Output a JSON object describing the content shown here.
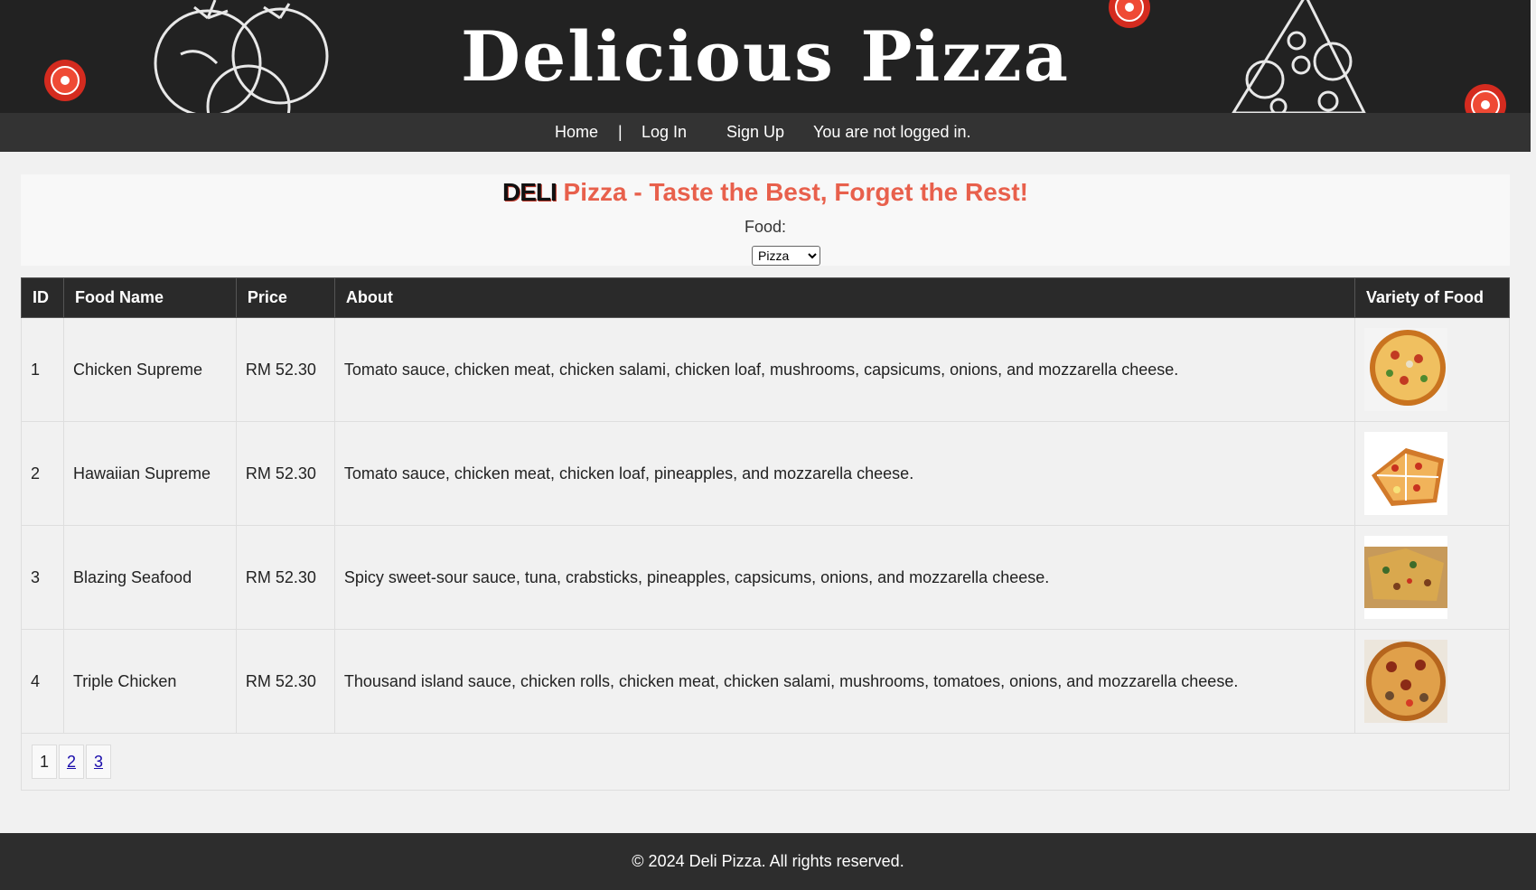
{
  "banner": {
    "title": "Delicious Pizza"
  },
  "nav": {
    "home": "Home",
    "separator": "|",
    "login": "Log In",
    "signup": "Sign Up",
    "status": "You are not logged in."
  },
  "hero": {
    "brand": "DELI",
    "tagline": "Pizza - Taste the Best, Forget the Rest!",
    "food_label": "Food:",
    "food_selected": "Pizza"
  },
  "table": {
    "headers": [
      "ID",
      "Food Name",
      "Price",
      "About",
      "Variety of Food"
    ],
    "rows": [
      {
        "id": "1",
        "name": "Chicken Supreme",
        "price": "RM 52.30",
        "about": "Tomato sauce, chicken meat, chicken salami, chicken loaf, mushrooms, capsicums, onions, and mozzarella cheese.",
        "image": "chicken-supreme-pizza-image"
      },
      {
        "id": "2",
        "name": "Hawaiian Supreme",
        "price": "RM 52.30",
        "about": "Tomato sauce, chicken meat, chicken loaf, pineapples, and mozzarella cheese.",
        "image": "hawaiian-supreme-pizza-image"
      },
      {
        "id": "3",
        "name": "Blazing Seafood",
        "price": "RM 52.30",
        "about": "Spicy sweet-sour sauce, tuna, crabsticks, pineapples, capsicums, onions, and mozzarella cheese.",
        "image": "blazing-seafood-pizza-image"
      },
      {
        "id": "4",
        "name": "Triple Chicken",
        "price": "RM 52.30",
        "about": "Thousand island sauce, chicken rolls, chicken meat, chicken salami, mushrooms, tomatoes, onions, and mozzarella cheese.",
        "image": "triple-chicken-pizza-image"
      }
    ]
  },
  "pagination": {
    "pages": [
      "1",
      "2",
      "3"
    ],
    "current": "1"
  },
  "footer": {
    "text": "© 2024 Deli Pizza. All rights reserved."
  },
  "colors": {
    "banner_bg": "#222222",
    "nav_bg": "#333333",
    "accent": "#e8604c",
    "link": "#1a0dab"
  }
}
